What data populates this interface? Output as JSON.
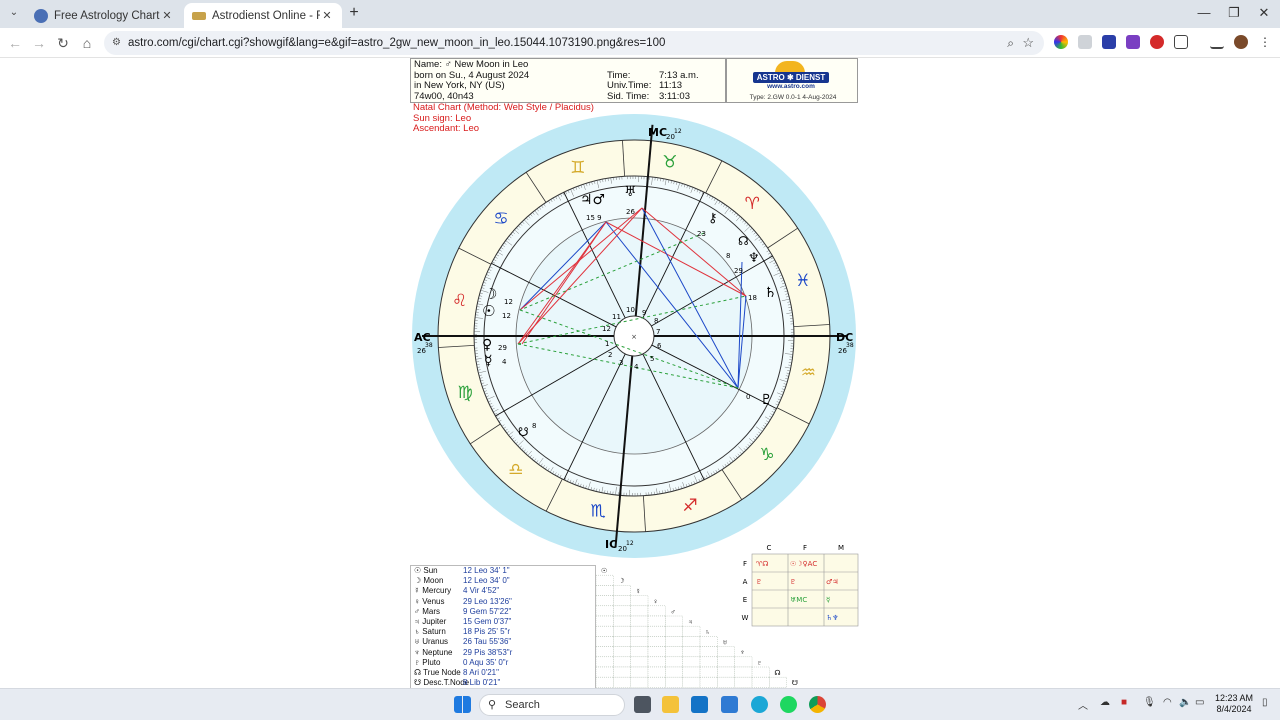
{
  "browser": {
    "tabs": [
      {
        "title": "Free Astrology Chart - Astrodie",
        "active": false
      },
      {
        "title": "Astrodienst Online - Free Astro",
        "active": true
      }
    ],
    "url": "astro.com/cgi/chart.cgi?showgif&lang=e&gif=astro_2gw_new_moon_in_leo.15044.1073190.png&res=100"
  },
  "header": {
    "name_line": "Name:  ♂  New Moon in Leo",
    "born_line": "born on Su., 4 August 2024",
    "place_line": "in New York, NY (US)",
    "coords_line": "74w00, 40n43",
    "time_label": "Time:",
    "time_value": "7:13 a.m.",
    "univ_label": "Univ.Time:",
    "univ_value": "11:13",
    "sid_label": "Sid. Time:",
    "sid_value": "3:11:03"
  },
  "logo": {
    "brand": "ASTRO ✱ DIENST",
    "url": "www.astro.com",
    "type_line": "Type: 2.GW   0.0-1   4-Aug-2024"
  },
  "natal": {
    "method": "Natal Chart  (Method: Web Style / Placidus)",
    "sun_sign": "Sun sign: Leo",
    "ascendant": "Ascendant: Leo"
  },
  "wheel": {
    "angles": {
      "mc": "MC",
      "mc_deg": "20",
      "mc_min": "12",
      "ic": "IC",
      "ic_deg": "20",
      "ic_min": "12",
      "ac": "AC",
      "ac_deg": "26",
      "ac_min": "38",
      "dc": "DC",
      "dc_deg": "26",
      "dc_min": "38"
    },
    "houses": [
      "1",
      "2",
      "3",
      "4",
      "5",
      "6",
      "7",
      "8",
      "9",
      "10",
      "11",
      "12"
    ],
    "signs": [
      "♌",
      "♋",
      "♊",
      "♉",
      "♈",
      "♓",
      "♒",
      "♑",
      "♐",
      "♏",
      "♎",
      "♍"
    ],
    "planet_glyphs": {
      "upper_left": "♃♂",
      "upper_left_deg": "15  9",
      "uranus": "♅",
      "uranus_deg": "26",
      "chiron": "⚷",
      "chiron_deg": "23",
      "node": "☊",
      "node_deg": "8",
      "neptune": "♆",
      "neptune_deg": "29",
      "saturn": "♄",
      "saturn_deg": "18",
      "moon": "☽",
      "sun": "☉",
      "sun_deg": "12",
      "moon_deg": "12",
      "venus": "♀",
      "venus_deg": "29",
      "mercury": "☿",
      "mercury_deg": "4",
      "south_node": "☋",
      "south_node_deg": "8",
      "pluto": "♇",
      "pluto_deg": "0"
    }
  },
  "planets": [
    {
      "glyph": "☉",
      "name": "Sun",
      "pos": "12 Leo 34'  1\""
    },
    {
      "glyph": "☽",
      "name": "Moon",
      "pos": "12 Leo 34'  0\""
    },
    {
      "glyph": "☿",
      "name": "Mercury",
      "pos": "4  Vir   4'52\""
    },
    {
      "glyph": "♀",
      "name": "Venus",
      "pos": "29 Leo 13'26\""
    },
    {
      "glyph": "♂",
      "name": "Mars",
      "pos": "9 Gem 57'22\""
    },
    {
      "glyph": "♃",
      "name": "Jupiter",
      "pos": "15 Gem  0'37\""
    },
    {
      "glyph": "♄",
      "name": "Saturn",
      "pos": "18  Pis  25'  5\"r"
    },
    {
      "glyph": "♅",
      "name": "Uranus",
      "pos": "26  Tau  55'36\""
    },
    {
      "glyph": "♆",
      "name": "Neptune",
      "pos": "29  Pis  38'53\"r"
    },
    {
      "glyph": "♇",
      "name": "Pluto",
      "pos": "0  Aqu  35'  0\"r"
    },
    {
      "glyph": "☊",
      "name": "True Node",
      "pos": "8  Ari   0'21\""
    },
    {
      "glyph": "☋",
      "name": "Desc.T.Node",
      "pos": "8  Lib   0'21\""
    }
  ],
  "elements": {
    "columns": [
      "C",
      "F",
      "M"
    ],
    "rows": [
      "F",
      "A",
      "E",
      "W"
    ]
  },
  "taskbar": {
    "search": "Search",
    "time": "12:23 AM",
    "date": "8/4/2024"
  },
  "colors": {
    "zodiac_ring": "#bfe9f5",
    "house_area": "#f2fbfd",
    "sign_band": "#fdfbe6",
    "aspect_blue": "#1c48c8",
    "aspect_red": "#e0323c",
    "aspect_green": "#2aa03a"
  }
}
